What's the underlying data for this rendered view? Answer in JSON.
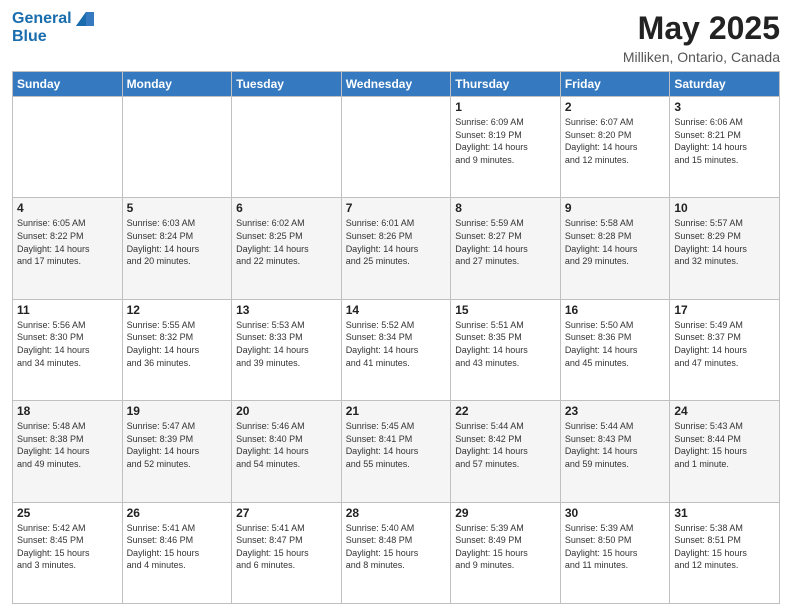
{
  "logo": {
    "line1": "General",
    "line2": "Blue"
  },
  "title": "May 2025",
  "subtitle": "Milliken, Ontario, Canada",
  "days_of_week": [
    "Sunday",
    "Monday",
    "Tuesday",
    "Wednesday",
    "Thursday",
    "Friday",
    "Saturday"
  ],
  "weeks": [
    [
      {
        "day": "",
        "info": ""
      },
      {
        "day": "",
        "info": ""
      },
      {
        "day": "",
        "info": ""
      },
      {
        "day": "",
        "info": ""
      },
      {
        "day": "1",
        "info": "Sunrise: 6:09 AM\nSunset: 8:19 PM\nDaylight: 14 hours\nand 9 minutes."
      },
      {
        "day": "2",
        "info": "Sunrise: 6:07 AM\nSunset: 8:20 PM\nDaylight: 14 hours\nand 12 minutes."
      },
      {
        "day": "3",
        "info": "Sunrise: 6:06 AM\nSunset: 8:21 PM\nDaylight: 14 hours\nand 15 minutes."
      }
    ],
    [
      {
        "day": "4",
        "info": "Sunrise: 6:05 AM\nSunset: 8:22 PM\nDaylight: 14 hours\nand 17 minutes."
      },
      {
        "day": "5",
        "info": "Sunrise: 6:03 AM\nSunset: 8:24 PM\nDaylight: 14 hours\nand 20 minutes."
      },
      {
        "day": "6",
        "info": "Sunrise: 6:02 AM\nSunset: 8:25 PM\nDaylight: 14 hours\nand 22 minutes."
      },
      {
        "day": "7",
        "info": "Sunrise: 6:01 AM\nSunset: 8:26 PM\nDaylight: 14 hours\nand 25 minutes."
      },
      {
        "day": "8",
        "info": "Sunrise: 5:59 AM\nSunset: 8:27 PM\nDaylight: 14 hours\nand 27 minutes."
      },
      {
        "day": "9",
        "info": "Sunrise: 5:58 AM\nSunset: 8:28 PM\nDaylight: 14 hours\nand 29 minutes."
      },
      {
        "day": "10",
        "info": "Sunrise: 5:57 AM\nSunset: 8:29 PM\nDaylight: 14 hours\nand 32 minutes."
      }
    ],
    [
      {
        "day": "11",
        "info": "Sunrise: 5:56 AM\nSunset: 8:30 PM\nDaylight: 14 hours\nand 34 minutes."
      },
      {
        "day": "12",
        "info": "Sunrise: 5:55 AM\nSunset: 8:32 PM\nDaylight: 14 hours\nand 36 minutes."
      },
      {
        "day": "13",
        "info": "Sunrise: 5:53 AM\nSunset: 8:33 PM\nDaylight: 14 hours\nand 39 minutes."
      },
      {
        "day": "14",
        "info": "Sunrise: 5:52 AM\nSunset: 8:34 PM\nDaylight: 14 hours\nand 41 minutes."
      },
      {
        "day": "15",
        "info": "Sunrise: 5:51 AM\nSunset: 8:35 PM\nDaylight: 14 hours\nand 43 minutes."
      },
      {
        "day": "16",
        "info": "Sunrise: 5:50 AM\nSunset: 8:36 PM\nDaylight: 14 hours\nand 45 minutes."
      },
      {
        "day": "17",
        "info": "Sunrise: 5:49 AM\nSunset: 8:37 PM\nDaylight: 14 hours\nand 47 minutes."
      }
    ],
    [
      {
        "day": "18",
        "info": "Sunrise: 5:48 AM\nSunset: 8:38 PM\nDaylight: 14 hours\nand 49 minutes."
      },
      {
        "day": "19",
        "info": "Sunrise: 5:47 AM\nSunset: 8:39 PM\nDaylight: 14 hours\nand 52 minutes."
      },
      {
        "day": "20",
        "info": "Sunrise: 5:46 AM\nSunset: 8:40 PM\nDaylight: 14 hours\nand 54 minutes."
      },
      {
        "day": "21",
        "info": "Sunrise: 5:45 AM\nSunset: 8:41 PM\nDaylight: 14 hours\nand 55 minutes."
      },
      {
        "day": "22",
        "info": "Sunrise: 5:44 AM\nSunset: 8:42 PM\nDaylight: 14 hours\nand 57 minutes."
      },
      {
        "day": "23",
        "info": "Sunrise: 5:44 AM\nSunset: 8:43 PM\nDaylight: 14 hours\nand 59 minutes."
      },
      {
        "day": "24",
        "info": "Sunrise: 5:43 AM\nSunset: 8:44 PM\nDaylight: 15 hours\nand 1 minute."
      }
    ],
    [
      {
        "day": "25",
        "info": "Sunrise: 5:42 AM\nSunset: 8:45 PM\nDaylight: 15 hours\nand 3 minutes."
      },
      {
        "day": "26",
        "info": "Sunrise: 5:41 AM\nSunset: 8:46 PM\nDaylight: 15 hours\nand 4 minutes."
      },
      {
        "day": "27",
        "info": "Sunrise: 5:41 AM\nSunset: 8:47 PM\nDaylight: 15 hours\nand 6 minutes."
      },
      {
        "day": "28",
        "info": "Sunrise: 5:40 AM\nSunset: 8:48 PM\nDaylight: 15 hours\nand 8 minutes."
      },
      {
        "day": "29",
        "info": "Sunrise: 5:39 AM\nSunset: 8:49 PM\nDaylight: 15 hours\nand 9 minutes."
      },
      {
        "day": "30",
        "info": "Sunrise: 5:39 AM\nSunset: 8:50 PM\nDaylight: 15 hours\nand 11 minutes."
      },
      {
        "day": "31",
        "info": "Sunrise: 5:38 AM\nSunset: 8:51 PM\nDaylight: 15 hours\nand 12 minutes."
      }
    ]
  ]
}
